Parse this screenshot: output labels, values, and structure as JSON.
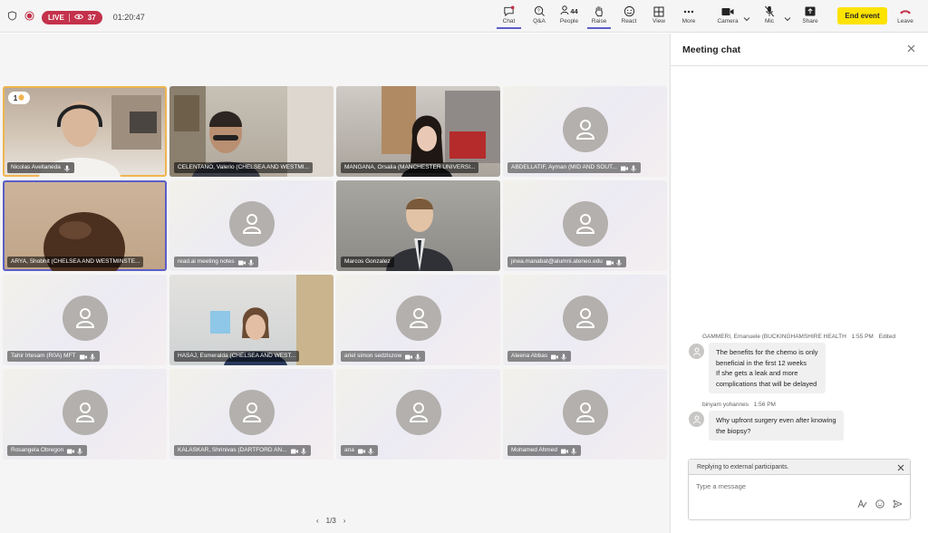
{
  "toolbar": {
    "live_label": "LIVE",
    "viewer_count": "37",
    "timer": "01:20:47",
    "buttons": [
      {
        "label": "Chat",
        "icon": "chat-icon",
        "active": true
      },
      {
        "label": "Q&A",
        "icon": "qa-icon"
      },
      {
        "label": "People",
        "icon": "people-icon",
        "count": "44"
      },
      {
        "label": "Raise",
        "icon": "raise-hand-icon",
        "active": true
      },
      {
        "label": "React",
        "icon": "react-icon"
      },
      {
        "label": "View",
        "icon": "view-icon"
      },
      {
        "label": "More",
        "icon": "more-icon"
      },
      {
        "label": "Camera",
        "icon": "camera-icon"
      },
      {
        "label": "Mic",
        "icon": "mic-off-icon"
      },
      {
        "label": "Share",
        "icon": "share-icon"
      },
      {
        "label": "End event"
      },
      {
        "label": "Leave",
        "icon": "leave-icon"
      }
    ]
  },
  "participants": [
    {
      "name": "Nicolas Avellaneda",
      "hand_raised": "1",
      "video": true
    },
    {
      "name": "CELENTANO, Valerio (CHELSEA AND WESTMI...",
      "video": true
    },
    {
      "name": "MANGANA, Orsalia (MANCHESTER UNIVERSI...",
      "video": true
    },
    {
      "name": "ABDELLATIF, Ayman (MID AND SOUT...",
      "video": false
    },
    {
      "name": "ARYA, Shobhit (CHELSEA AND WESTMINSTE...",
      "video": true
    },
    {
      "name": "read.ai meeting notes",
      "video": false
    },
    {
      "name": "Marcos Gonzalez",
      "video": true
    },
    {
      "name": "jinea.manabat@alumni.ateneo.edu",
      "video": false
    },
    {
      "name": "Tahir Irtesam (R0A) MFT",
      "video": false
    },
    {
      "name": "HASAJ, Esmeralda (CHELSEA AND WEST...",
      "video": true
    },
    {
      "name": "ariel simon sedziszow",
      "video": false
    },
    {
      "name": "Aleena Abbas",
      "video": false
    },
    {
      "name": "Rosangela Obregon",
      "video": false
    },
    {
      "name": "KALASKAR, Shrinivas (DARTFORD AN...",
      "video": false
    },
    {
      "name": "ana",
      "video": false
    },
    {
      "name": "Mohamed Ahmed",
      "video": false
    }
  ],
  "pager": {
    "label": "1/3",
    "prev": "‹",
    "next": "›"
  },
  "chat": {
    "title": "Meeting chat",
    "messages": [
      {
        "sender": "GAMMERI, Emanuele (BUCKINGHAMSHIRE HEALTH",
        "time": "1:55 PM",
        "status": "Edited",
        "lines": [
          "The benefits for the chemo is only",
          "beneficial in the first 12 weeks",
          "If she gets a leak and more",
          "complications that will be delayed"
        ]
      },
      {
        "sender": "binyam yohannes",
        "time": "1:56 PM",
        "status": "",
        "lines": [
          "Why upfront surgery even after knowing",
          "the biopsy?"
        ]
      }
    ],
    "reply_banner": "Replying to external participants.",
    "input_placeholder": "Type a message"
  },
  "colors": {
    "accent": "#5b5fc7",
    "end_event": "#fde300",
    "live": "#c4314b",
    "leave": "#c4314b"
  }
}
